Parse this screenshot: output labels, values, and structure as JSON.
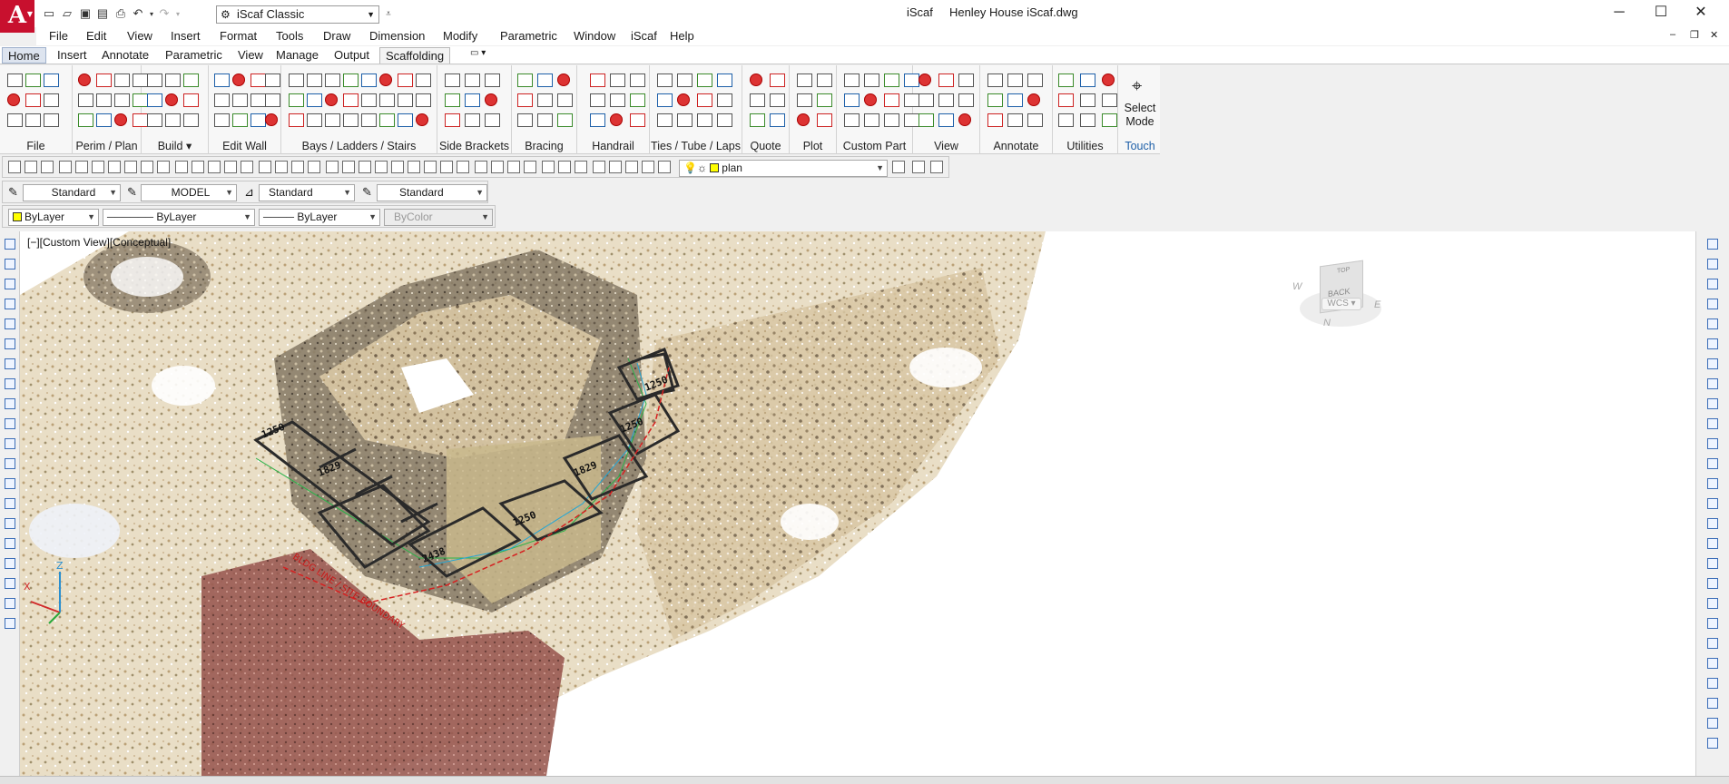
{
  "app": {
    "logo_letter": "A",
    "title": "iScaf     Henley House iScaf.dwg",
    "workspace": "iScaf Classic"
  },
  "menu": [
    "File",
    "Edit",
    "View",
    "Insert",
    "Format",
    "Tools",
    "Draw",
    "Dimension",
    "Modify",
    "Parametric",
    "Window",
    "iScaf",
    "Help"
  ],
  "ribbon_tabs": [
    "Home",
    "Insert",
    "Annotate",
    "Parametric",
    "View",
    "Manage",
    "Output",
    "Scaffolding"
  ],
  "ribbon_active_tab": "Scaffolding",
  "ribbon_panels": [
    "File",
    "Perim / Plan",
    "Build",
    "Edit Wall",
    "Bays / Ladders / Stairs",
    "Side Brackets",
    "Bracing",
    "Handrail",
    "Ties / Tube / Laps",
    "Quote",
    "Plot",
    "Custom Part",
    "View",
    "Annotate",
    "Utilities"
  ],
  "build_caret": "▾",
  "select_mode": {
    "line1": "Select",
    "line2": "Mode",
    "touch": "Touch"
  },
  "layer_toolbar": {
    "layer": "plan"
  },
  "styles_toolbar": {
    "text_style": "Standard",
    "layout": "MODEL",
    "dim_style": "Standard",
    "table_style": "Standard"
  },
  "properties_toolbar": {
    "color": "ByLayer",
    "linetype": "ByLayer",
    "lineweight": "ByLayer",
    "plotstyle": "ByColor"
  },
  "viewport": {
    "label": "[−][Custom View][Conceptual]",
    "viewcube_face_top": "TOP",
    "viewcube_face_front": "BACK",
    "compass_n": "N",
    "compass_w": "W",
    "compass_e": "E",
    "wcs": "WCS",
    "ucs_x": "X",
    "ucs_z": "Z"
  },
  "drawing_labels": {
    "bay_size_a": "1250",
    "bay_size_b": "1829",
    "bay_size_c": "2438",
    "boundary_note": "BLDG LINE / SITE BOUNDARY"
  },
  "colors": {
    "accent": "#c8102e",
    "ribbon_bg": "#f7f7f7",
    "scaffold_line": "#2a2a2a",
    "tie_line": "#d62020",
    "guide_green": "#29b34a",
    "guide_cyan": "#23a6d5"
  }
}
